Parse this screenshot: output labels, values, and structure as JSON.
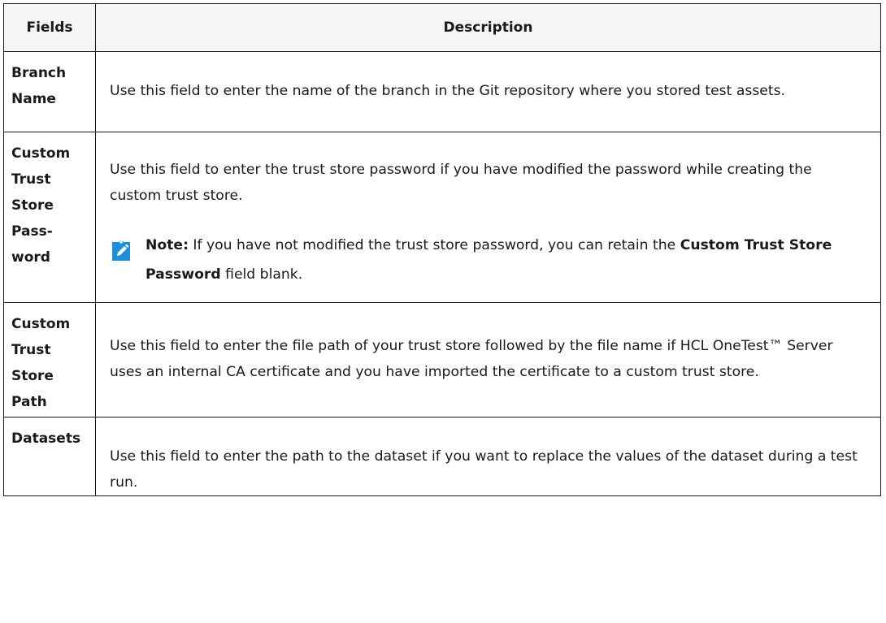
{
  "table": {
    "headers": {
      "fields": "Fields",
      "description": "Description"
    },
    "rows": [
      {
        "field_lines": [
          "Branch",
          "Name"
        ],
        "description": "Use this field to enter the name of the branch in the Git repository where you stored test assets."
      },
      {
        "field_lines": [
          "Custom",
          "Trust",
          "Store",
          "Pass-",
          "word"
        ],
        "description": "Use this field to enter the trust store password if you have modified the password while creating the custom trust store.",
        "note": {
          "label": "Note:",
          "text_before": " If you have not modified the trust store password, you can retain the ",
          "bold_field": "Custom Trust Store Password",
          "text_after": " field blank.",
          "icon": "note-pencil-icon",
          "icon_color": "#1d8fd6"
        }
      },
      {
        "field_lines": [
          "Custom",
          "Trust",
          "Store",
          "Path"
        ],
        "description": "Use this field to enter the file path of your trust store followed by the file name if HCL OneTest™ Server uses an internal CA certificate and you have imported the certificate to a custom trust store."
      },
      {
        "field_lines": [
          "Datasets"
        ],
        "description": "Use this field to enter the path to the dataset if you want to replace the values of the dataset during a test run."
      }
    ]
  }
}
